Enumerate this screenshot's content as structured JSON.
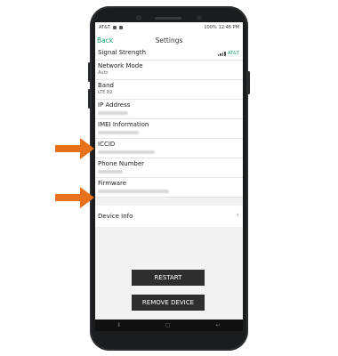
{
  "status_bar": {
    "carrier": "AT&T",
    "battery": "100%",
    "time": "12:45 PM"
  },
  "app_bar": {
    "back_label": "Back",
    "title": "Settings"
  },
  "rows": [
    {
      "label": "Signal Strength",
      "value": "",
      "right_text": "AT&T"
    },
    {
      "label": "Network Mode",
      "value": "Auto"
    },
    {
      "label": "Band",
      "value": "LTE B2"
    },
    {
      "label": "IP Address",
      "value": ""
    },
    {
      "label": "IMEI Information",
      "value": ""
    },
    {
      "label": "ICCID",
      "value": ""
    },
    {
      "label": "Phone Number",
      "value": ""
    },
    {
      "label": "Firmware",
      "value": ""
    }
  ],
  "device_info": {
    "label": "Device Info"
  },
  "buttons": {
    "restart": "RESTART",
    "remove": "REMOVE DEVICE"
  },
  "colors": {
    "accent": "#1aa370",
    "arrow": "#e8711c",
    "button": "#2e2e2e"
  },
  "icons": [
    "signal-bars-icon",
    "chevron-right-icon",
    "arrow-right-icon",
    "back-nav-icon",
    "home-nav-icon",
    "recents-nav-icon"
  ]
}
